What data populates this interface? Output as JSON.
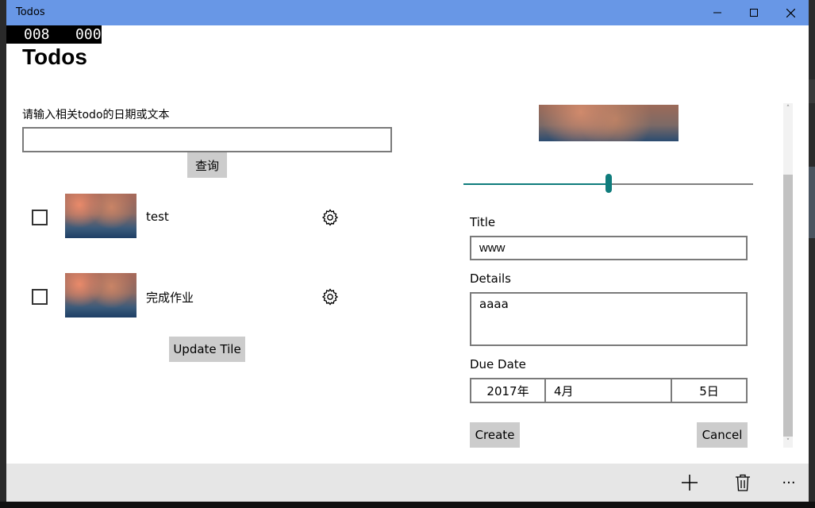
{
  "window": {
    "title": "Todos"
  },
  "fps_counter": {
    "left": "008",
    "right": "000"
  },
  "page": {
    "title": "Todos"
  },
  "search": {
    "label": "请输入相关todo的日期或文本",
    "value": "",
    "button_label": "查询"
  },
  "todo_list": {
    "items": [
      {
        "title": "test",
        "completed": false
      },
      {
        "title": "完成作业",
        "completed": false
      }
    ],
    "update_tile_label": "Update Tile"
  },
  "editor": {
    "slider_value_fraction": 0.5,
    "title_label": "Title",
    "title_value": "www",
    "details_label": "Details",
    "details_value": "aaaa",
    "due_date_label": "Due Date",
    "due_date": {
      "year": "2017年",
      "month": "4月",
      "day": "5日"
    },
    "create_label": "Create",
    "cancel_label": "Cancel"
  },
  "appbar": {
    "icons": [
      "add-icon",
      "delete-icon",
      "more-icon"
    ],
    "more_label": "···"
  },
  "colors": {
    "titlebar": "#6897e6",
    "accent": "#0f7c7c",
    "button": "#cccccc",
    "appbar": "#e6e6e6"
  }
}
